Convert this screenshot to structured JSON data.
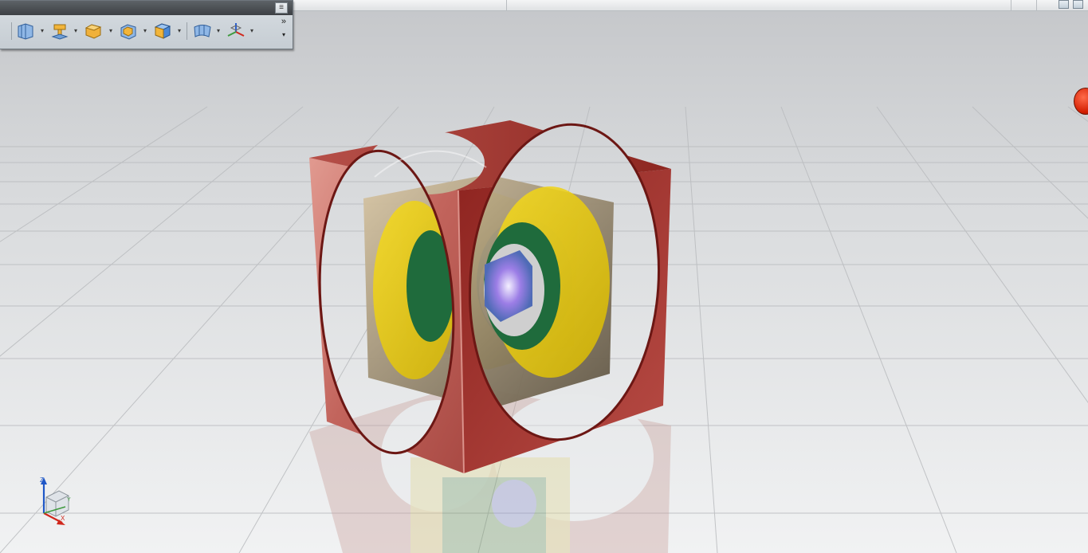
{
  "window": {
    "panel_menu_glyph": "≡",
    "overflow_glyph": "»",
    "overflow_small_glyph": "▾"
  },
  "toolbar": {
    "tools": [
      {
        "name": "view-cube-tool-icon"
      },
      {
        "name": "extrude-tool-icon"
      },
      {
        "name": "box-tool-icon"
      },
      {
        "name": "shell-tool-icon"
      },
      {
        "name": "solid-box-tool-icon"
      },
      {
        "name": "surface-tool-icon"
      },
      {
        "name": "datum-csys-tool-icon"
      }
    ],
    "dropdown_glyph": "▾"
  },
  "triad": {
    "z_label": "Z",
    "x_label": "X",
    "y_label": "Y"
  },
  "colors": {
    "outer_cube": "#b14a45",
    "second_cube": "#6b6350",
    "third_cube": "#e5c400",
    "fourth_cube": "#1f6b3c",
    "inner_cube": "#6f7fb8",
    "indicator": "#e02a08"
  }
}
